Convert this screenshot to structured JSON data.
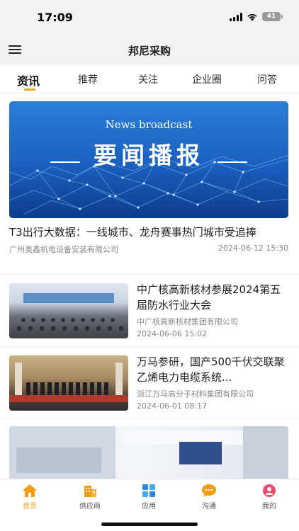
{
  "status_bar": {
    "time": "17:09",
    "battery": "41",
    "icons": [
      "signal-icon",
      "wifi-icon",
      "battery-icon"
    ]
  },
  "nav": {
    "title": "邦尼采购",
    "menu_icon": "menu-icon"
  },
  "tabs": [
    {
      "label": "资讯",
      "active": true
    },
    {
      "label": "推荐",
      "active": false
    },
    {
      "label": "关注",
      "active": false
    },
    {
      "label": "企业圈",
      "active": false
    },
    {
      "label": "问答",
      "active": false
    }
  ],
  "feed": {
    "featured": {
      "banner_en": "News broadcast",
      "banner_cn": "要闻播报",
      "title": "T3出行大数据：一线城市、龙舟赛事热门城市受追捧",
      "source": "广州奥鑫机电设备安装有限公司",
      "date": "2024-06-12 15:30"
    },
    "items": [
      {
        "title": "中广核高新核材参展2024第五届防水行业大会",
        "source": "中广核高新核材集团有限公司",
        "date": "2024-06-06 15:02"
      },
      {
        "title": "万马参研，国产500千伏交联聚乙烯电力电缆系统...",
        "source": "浙江万马高分子材料集团有限公司",
        "date": "2024-06-01 08:17"
      }
    ]
  },
  "tabbar": [
    {
      "label": "首页",
      "icon": "home-icon",
      "active": true
    },
    {
      "label": "供应商",
      "icon": "building-icon",
      "active": false
    },
    {
      "label": "应用",
      "icon": "apps-grid-icon",
      "active": false
    },
    {
      "label": "沟通",
      "icon": "chat-bubble-icon",
      "active": false
    },
    {
      "label": "我的",
      "icon": "profile-icon",
      "active": false
    }
  ],
  "colors": {
    "accent": "#f5a623",
    "active_tab_label": "#f39c12",
    "header_bg": "#f2f2f2",
    "banner_blue": "#1a5fbf"
  }
}
